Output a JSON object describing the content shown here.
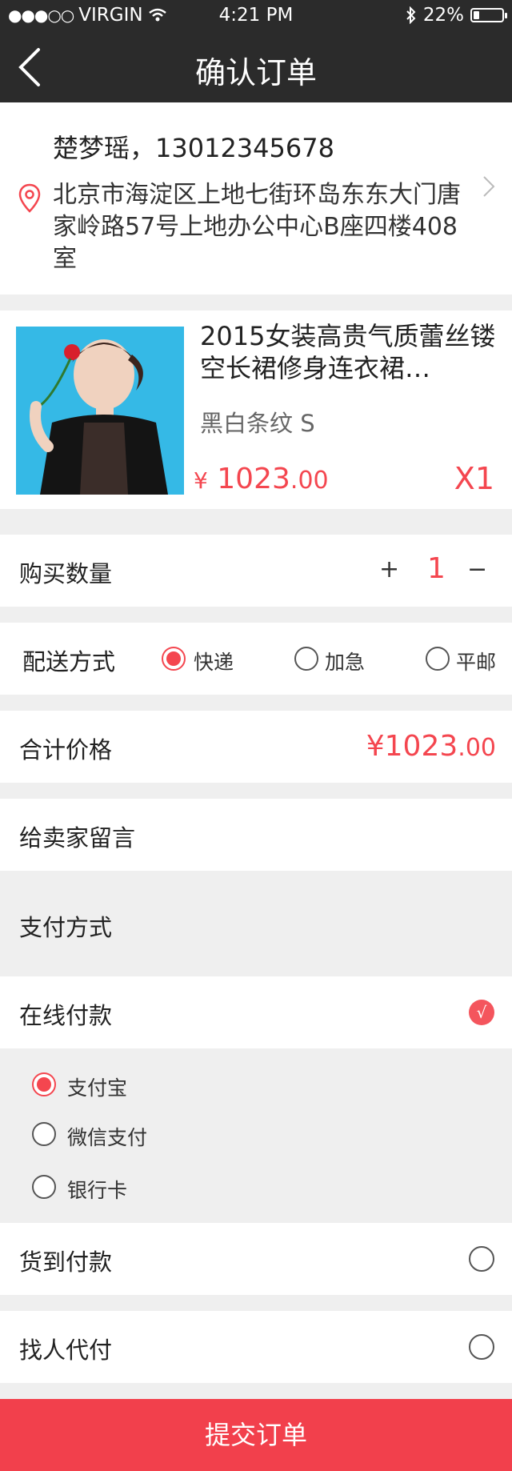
{
  "status_bar": {
    "carrier": "VIRGIN",
    "time": "4:21 PM",
    "battery": "22%",
    "battery_level": 0.22
  },
  "nav": {
    "title": "确认订单",
    "back_icon": "chevron-left-icon"
  },
  "address": {
    "name_phone": "楚梦瑶，13012345678",
    "detail": "北京市海淀区上地七街环岛东东大门唐家岭路57号上地办公中心B座四楼408室"
  },
  "product": {
    "title": "2015女装高贵气质蕾丝镂空长裙修身连衣裙…",
    "spec": "黑白条纹   S",
    "price_symbol": "¥",
    "price_int": "1023",
    "price_cents": ".00",
    "quantity": "X1"
  },
  "quantity_row": {
    "label": "购买数量",
    "plus": "+",
    "value": "1",
    "minus": "−"
  },
  "delivery": {
    "label": "配送方式",
    "options": [
      {
        "label": "快递",
        "selected": true
      },
      {
        "label": "加急",
        "selected": false
      },
      {
        "label": "平邮",
        "selected": false
      }
    ]
  },
  "total": {
    "label": "合计价格",
    "price_int": "¥1023",
    "price_cents": ".00"
  },
  "message": {
    "label": "给卖家留言"
  },
  "payment": {
    "section_label": "支付方式",
    "online": {
      "label": "在线付款",
      "checked": true,
      "check_glyph": "√"
    },
    "online_options": [
      {
        "label": "支付宝",
        "selected": true
      },
      {
        "label": "微信支付",
        "selected": false
      },
      {
        "label": "银行卡",
        "selected": false
      }
    ],
    "cod": {
      "label": "货到付款",
      "checked": false
    },
    "proxy": {
      "label": "找人代付",
      "checked": false
    }
  },
  "submit": {
    "label": "提交订单"
  },
  "colors": {
    "accent": "#f4464f",
    "header": "#2b2b2b",
    "background": "#efefef"
  }
}
